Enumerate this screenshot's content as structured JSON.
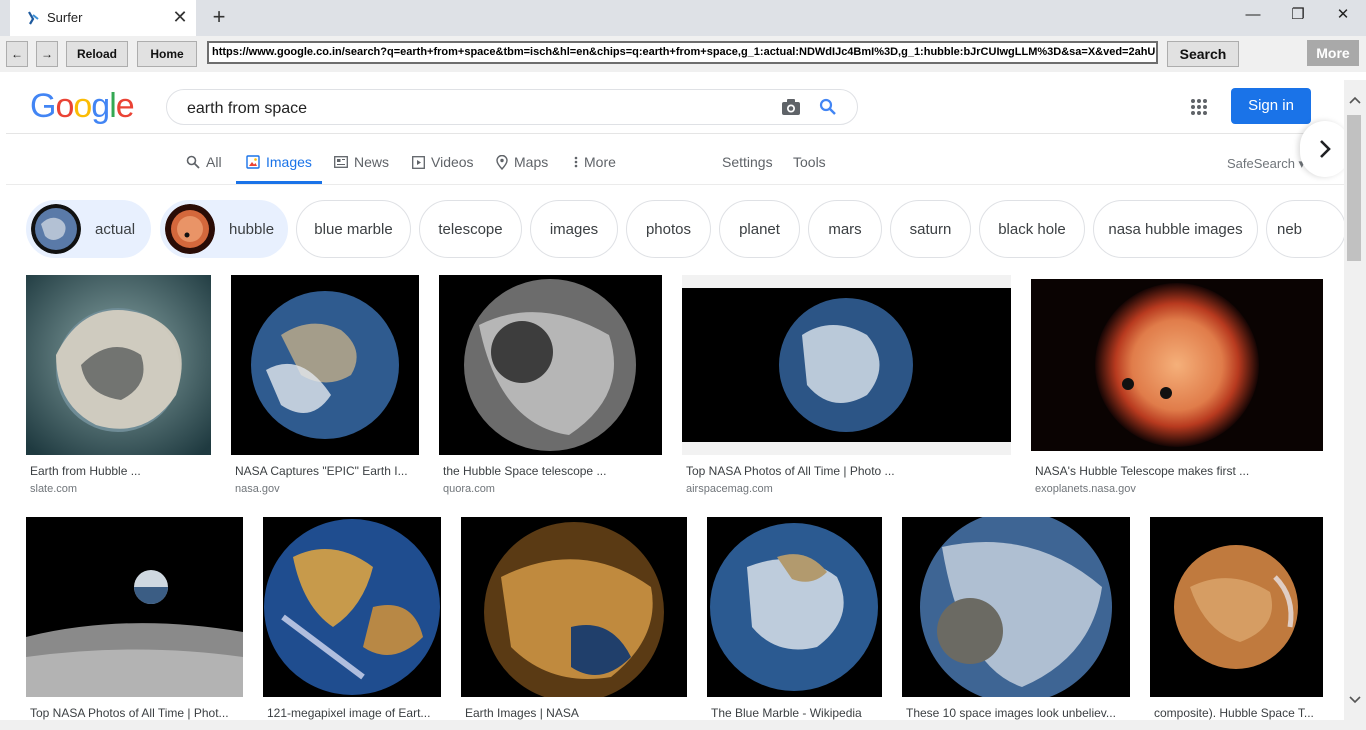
{
  "window": {
    "tab_title": "Surfer",
    "close_glyph": "✕",
    "new_tab_glyph": "+",
    "minimize_glyph": "—",
    "maximize_glyph": "❐",
    "close_window_glyph": "✕"
  },
  "toolbar": {
    "back": "←",
    "forward": "→",
    "reload": "Reload",
    "home": "Home",
    "url": "https://www.google.co.in/search?q=earth+from+space&tbm=isch&hl=en&chips=q:earth+from+space,g_1:actual:NDWdIJc4BmI%3D,g_1:hubble:bJrCUIwgLLM%3D&sa=X&ved=2ahU",
    "search": "Search",
    "more": "More"
  },
  "google": {
    "logo_letters": [
      "G",
      "o",
      "o",
      "g",
      "l",
      "e"
    ],
    "logo_colors": [
      "#4285f4",
      "#ea4335",
      "#fbbc05",
      "#4285f4",
      "#34a853",
      "#ea4335"
    ],
    "query": "earth from space",
    "sign_in": "Sign in",
    "accent": "#1a73e8"
  },
  "nav": {
    "all": "All",
    "images": "Images",
    "news": "News",
    "videos": "Videos",
    "maps": "Maps",
    "more": "More",
    "settings": "Settings",
    "tools": "Tools",
    "safesearch": "SafeSearch ▾"
  },
  "chips": [
    "actual",
    "hubble",
    "blue marble",
    "telescope",
    "images",
    "photos",
    "planet",
    "mars",
    "saturn",
    "black hole",
    "nasa hubble images",
    "neb"
  ],
  "results": [
    {
      "title": "Earth from Hubble ...",
      "source": "slate.com"
    },
    {
      "title": "NASA Captures \"EPIC\" Earth I...",
      "source": "nasa.gov"
    },
    {
      "title": "the Hubble Space telescope ...",
      "source": "quora.com"
    },
    {
      "title": "Top NASA Photos of All Time | Photo ...",
      "source": "airspacemag.com"
    },
    {
      "title": "NASA's Hubble Telescope makes first ...",
      "source": "exoplanets.nasa.gov"
    },
    {
      "title": "Top NASA Photos of All Time | Phot...",
      "source": ""
    },
    {
      "title": "121-megapixel image of Eart...",
      "source": ""
    },
    {
      "title": "Earth Images | NASA",
      "source": ""
    },
    {
      "title": "The Blue Marble - Wikipedia",
      "source": ""
    },
    {
      "title": "These 10 space images look unbeliev...",
      "source": ""
    },
    {
      "title": "composite). Hubble Space T...",
      "source": ""
    }
  ]
}
